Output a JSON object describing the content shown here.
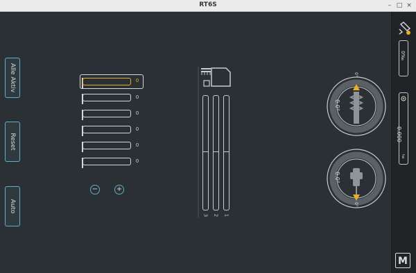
{
  "window": {
    "title": "RT6S",
    "minimize": "–",
    "maximize": "□",
    "close": "×"
  },
  "left_buttons": [
    {
      "label": "Alle Aktiv"
    },
    {
      "label": "Reset"
    },
    {
      "label": "Auto"
    }
  ],
  "sections": [
    {
      "value": "0"
    },
    {
      "value": "0"
    },
    {
      "value": "0"
    },
    {
      "value": "0"
    },
    {
      "value": "0"
    },
    {
      "value": "0"
    }
  ],
  "controls": {
    "minus": "−",
    "plus": "+"
  },
  "columns": [
    {
      "label": "3"
    },
    {
      "label": "2"
    },
    {
      "label": "1"
    }
  ],
  "gauges": [
    {
      "angle_text": "0.0°",
      "scale_zero": "0°"
    },
    {
      "angle_text": "0.0°",
      "scale_zero": "0°"
    }
  ],
  "right_panel": {
    "percent": "0‰",
    "area": "0.000",
    "area_unit": "ha",
    "logo": "M"
  },
  "colors": {
    "accent": "#e8b21e",
    "button_border": "#5fb0c8",
    "background": "#2b3035"
  }
}
